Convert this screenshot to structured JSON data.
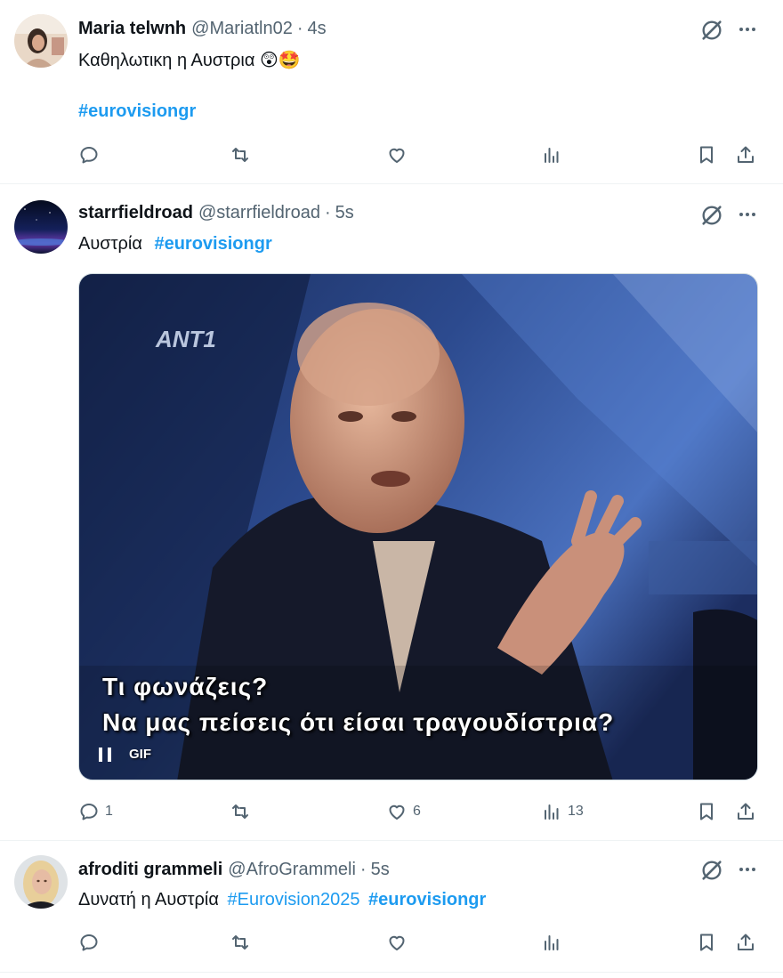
{
  "posts": [
    {
      "name": "Maria telwnh",
      "handle": "@Mariatln02",
      "dot": "·",
      "time": "4s",
      "text_main": "Καθηλωτικη η Αυστρια",
      "emoji": "😲🤩",
      "hashtag": "#eurovisiongr",
      "counts": {
        "reply": "",
        "repost": "",
        "like": "",
        "views": ""
      }
    },
    {
      "name": "starrfieldroad",
      "handle": "@starrfieldroad",
      "dot": "·",
      "time": "5s",
      "text_main": "Αυστρία",
      "hashtag": "#eurovisiongr",
      "media": {
        "caption_line1": "Τι φωνάζεις?",
        "caption_line2": "Να μας πείσεις ότι είσαι τραγουδίστρια?",
        "badge": "GIF"
      },
      "counts": {
        "reply": "1",
        "repost": "",
        "like": "6",
        "views": "13"
      }
    },
    {
      "name": "afroditi grammeli",
      "handle": "@AfroGrammeli",
      "dot": "·",
      "time": "5s",
      "text_main": "Δυνατή η Αυστρία",
      "hashtag_1": "#Eurovision2025",
      "hashtag_2": "#eurovisiongr",
      "counts": {
        "reply": "",
        "repost": "",
        "like": "",
        "views": ""
      }
    }
  ],
  "icons": {
    "reply": "reply-icon",
    "repost": "repost-icon",
    "like": "like-icon",
    "views": "views-icon",
    "bookmark": "bookmark-icon",
    "share": "share-icon",
    "grok": "grok-icon",
    "more": "more-icon"
  },
  "colors": {
    "accent": "#1d9bf0",
    "secondary_text": "#536471",
    "divider": "#eff3f4"
  }
}
